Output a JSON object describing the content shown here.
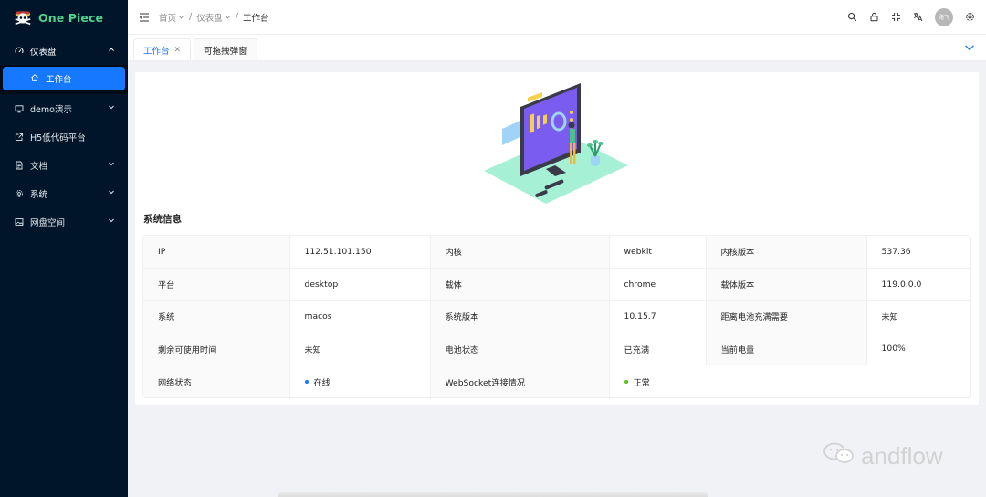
{
  "app": {
    "name": "One Piece"
  },
  "sidebar": {
    "items": [
      {
        "label": "仪表盘",
        "icon": "dashboard-icon",
        "open": true,
        "children": [
          {
            "label": "工作台",
            "icon": "home-icon",
            "active": true
          }
        ]
      },
      {
        "label": "demo演示",
        "icon": "monitor-icon",
        "has_children": true
      },
      {
        "label": "H5低代码平台",
        "icon": "external-link-icon",
        "has_children": false
      },
      {
        "label": "文档",
        "icon": "file-text-icon",
        "has_children": true
      },
      {
        "label": "系统",
        "icon": "settings-icon",
        "has_children": true
      },
      {
        "label": "网盘空间",
        "icon": "picture-icon",
        "has_children": true
      }
    ]
  },
  "header": {
    "breadcrumb": [
      {
        "label": "首页"
      },
      {
        "label": "仪表盘"
      },
      {
        "label": "工作台"
      }
    ],
    "avatar_text": "路飞"
  },
  "tabs": [
    {
      "label": "工作台",
      "active": true,
      "closable": true
    },
    {
      "label": "可拖拽弹窗",
      "active": false,
      "closable": false
    }
  ],
  "main": {
    "section_title": "系统信息",
    "rows": [
      [
        {
          "label": "IP",
          "value": "112.51.101.150"
        },
        {
          "label": "内核",
          "value": "webkit"
        },
        {
          "label": "内核版本",
          "value": "537.36"
        }
      ],
      [
        {
          "label": "平台",
          "value": "desktop"
        },
        {
          "label": "载体",
          "value": "chrome"
        },
        {
          "label": "载体版本",
          "value": "119.0.0.0"
        }
      ],
      [
        {
          "label": "系统",
          "value": "macos"
        },
        {
          "label": "系统版本",
          "value": "10.15.7"
        },
        {
          "label": "距离电池充满需要",
          "value": "未知"
        }
      ],
      [
        {
          "label": "剩余可使用时间",
          "value": "未知"
        },
        {
          "label": "电池状态",
          "value": "已充满"
        },
        {
          "label": "当前电量",
          "value": "100%"
        }
      ],
      [
        {
          "label": "网络状态",
          "value": "在线",
          "dot_color": "#1677ff"
        },
        {
          "label": "WebSocket连接情况",
          "value": "正常",
          "dot_color": "#52c41a"
        }
      ]
    ]
  },
  "watermark": {
    "text": "andflow"
  },
  "colors": {
    "sidebar_bg": "#001529",
    "accent": "#1677ff",
    "logo_green": "#4fd38d",
    "online_dot": "#1677ff",
    "ok_dot": "#52c41a"
  }
}
